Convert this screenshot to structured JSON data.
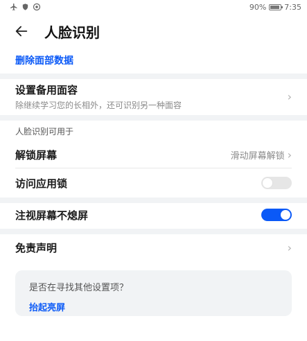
{
  "status_bar": {
    "icons": [
      "airplane-icon",
      "shield-icon",
      "vpn-icon"
    ],
    "battery_percent_text": "90%",
    "battery_level": 0.9,
    "time": "7:35"
  },
  "header": {
    "back_icon": "arrow-left-icon",
    "title": "人脸识别"
  },
  "delete_face_data": "删除面部数据",
  "backup_face": {
    "title": "设置备用面容",
    "subtitle": "除继续学习您的长相外，还可识别另一种面容"
  },
  "section_usage": {
    "label": "人脸识别可用于",
    "unlock_screen": {
      "title": "解锁屏幕",
      "value": "滑动屏幕解锁"
    },
    "app_lock": {
      "title": "访问应用锁",
      "toggle_on": false
    }
  },
  "gaze_keep_on": {
    "title": "注视屏幕不熄屏",
    "toggle_on": true
  },
  "disclaimer": {
    "title": "免责声明"
  },
  "suggestion_card": {
    "question": "是否在寻找其他设置项？",
    "link": "抬起亮屏"
  },
  "colors": {
    "accent": "#0a59f7",
    "band": "#f1f3f5"
  }
}
